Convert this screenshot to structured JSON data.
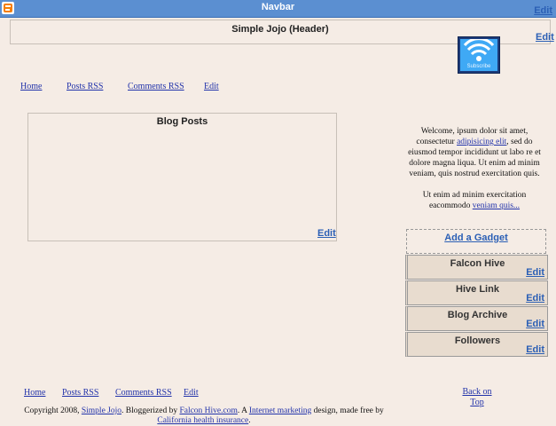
{
  "navbar": {
    "title": "Navbar",
    "edit_label": "Edit"
  },
  "header": {
    "title": "Simple Jojo (Header)",
    "edit_label": "Edit"
  },
  "subscribe": {
    "label": "Subscribe"
  },
  "top_nav": [
    "Home",
    "Posts RSS",
    "Comments RSS",
    "Edit"
  ],
  "blog_posts": {
    "title": "Blog Posts",
    "edit_label": "Edit"
  },
  "sidebar": {
    "welcome_p1_before": "Welcome, ipsum dolor sit amet, consectetur ",
    "welcome_p1_link": "adipisicing elit",
    "welcome_p1_after": ", sed do eiusmod tempor incididunt ut labo re et dolore magna liqua. Ut enim ad minim veniam, quis nostrud exercitation quis.",
    "welcome_p2_before": "Ut enim ad minim exercitation eacommodo ",
    "welcome_p2_link": "veniam quis...",
    "add_gadget": "Add a Gadget",
    "gadgets": [
      {
        "title": "Falcon Hive",
        "edit": "Edit"
      },
      {
        "title": "Hive Link",
        "edit": "Edit"
      },
      {
        "title": "Blog Archive",
        "edit": "Edit"
      },
      {
        "title": "Followers",
        "edit": "Edit"
      }
    ]
  },
  "footer": {
    "nav": [
      "Home",
      "Posts RSS",
      "Comments RSS",
      "Edit"
    ],
    "back_to_top": "Back on Top",
    "copyright": {
      "t1": "Copyright 2008, ",
      "l1": "Simple Jojo",
      "t2": ". Bloggerized by ",
      "l2": "Falcon Hive.com",
      "t3": ". A ",
      "l3": "Internet marketing",
      "t4": " design, made free by ",
      "l4": "California health insurance",
      "t5": "."
    }
  },
  "colors": {
    "background": "#f5ece5",
    "navbar": "#5b8fd1",
    "link": "#2233aa",
    "edit_link": "#2b5fb5",
    "gadget_bg": "#e8dccf"
  }
}
